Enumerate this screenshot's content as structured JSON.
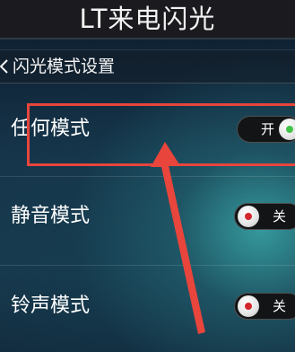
{
  "header": {
    "title": "LT来电闪光"
  },
  "section": {
    "label": "闪光模式设置",
    "icon": "chevron-left-icon"
  },
  "settings": [
    {
      "label": "任何模式",
      "toggle_text": "开",
      "state": "on"
    },
    {
      "label": "静音模式",
      "toggle_text": "关",
      "state": "off"
    },
    {
      "label": "铃声模式",
      "toggle_text": "关",
      "state": "off"
    }
  ],
  "colors": {
    "annotation_red": "#e8453c",
    "knob_on_dot": "#43c24a",
    "knob_off_dot": "#d4262c"
  }
}
